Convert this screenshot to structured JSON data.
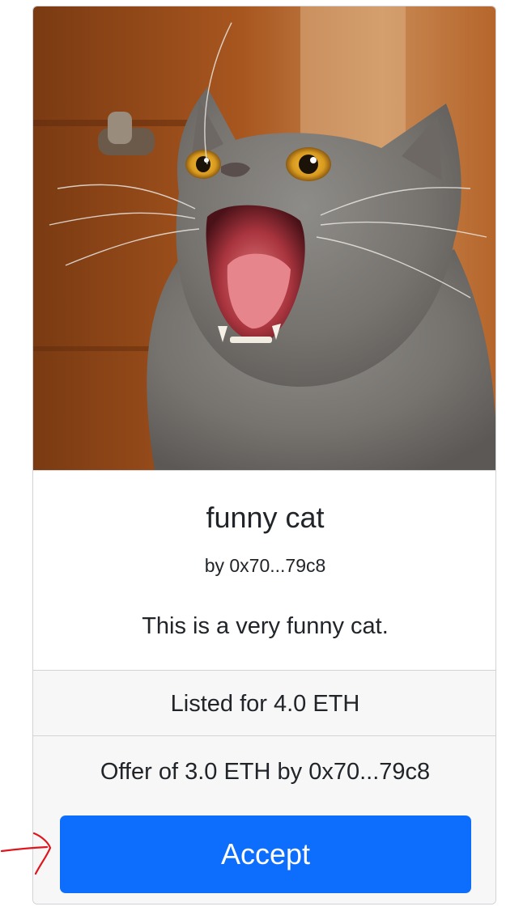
{
  "listing": {
    "title": "funny cat",
    "author": "by 0x70...79c8",
    "description": "This is a very funny cat.",
    "listed_price": "Listed for 4.0 ETH",
    "offer": "Offer of 3.0 ETH by 0x70...79c8",
    "accept_label": "Accept"
  },
  "colors": {
    "accent": "#0d6efd",
    "annotation_arrow": "#e0141c"
  },
  "icons": {
    "annotation": "hand-drawn-arrow-icon"
  }
}
